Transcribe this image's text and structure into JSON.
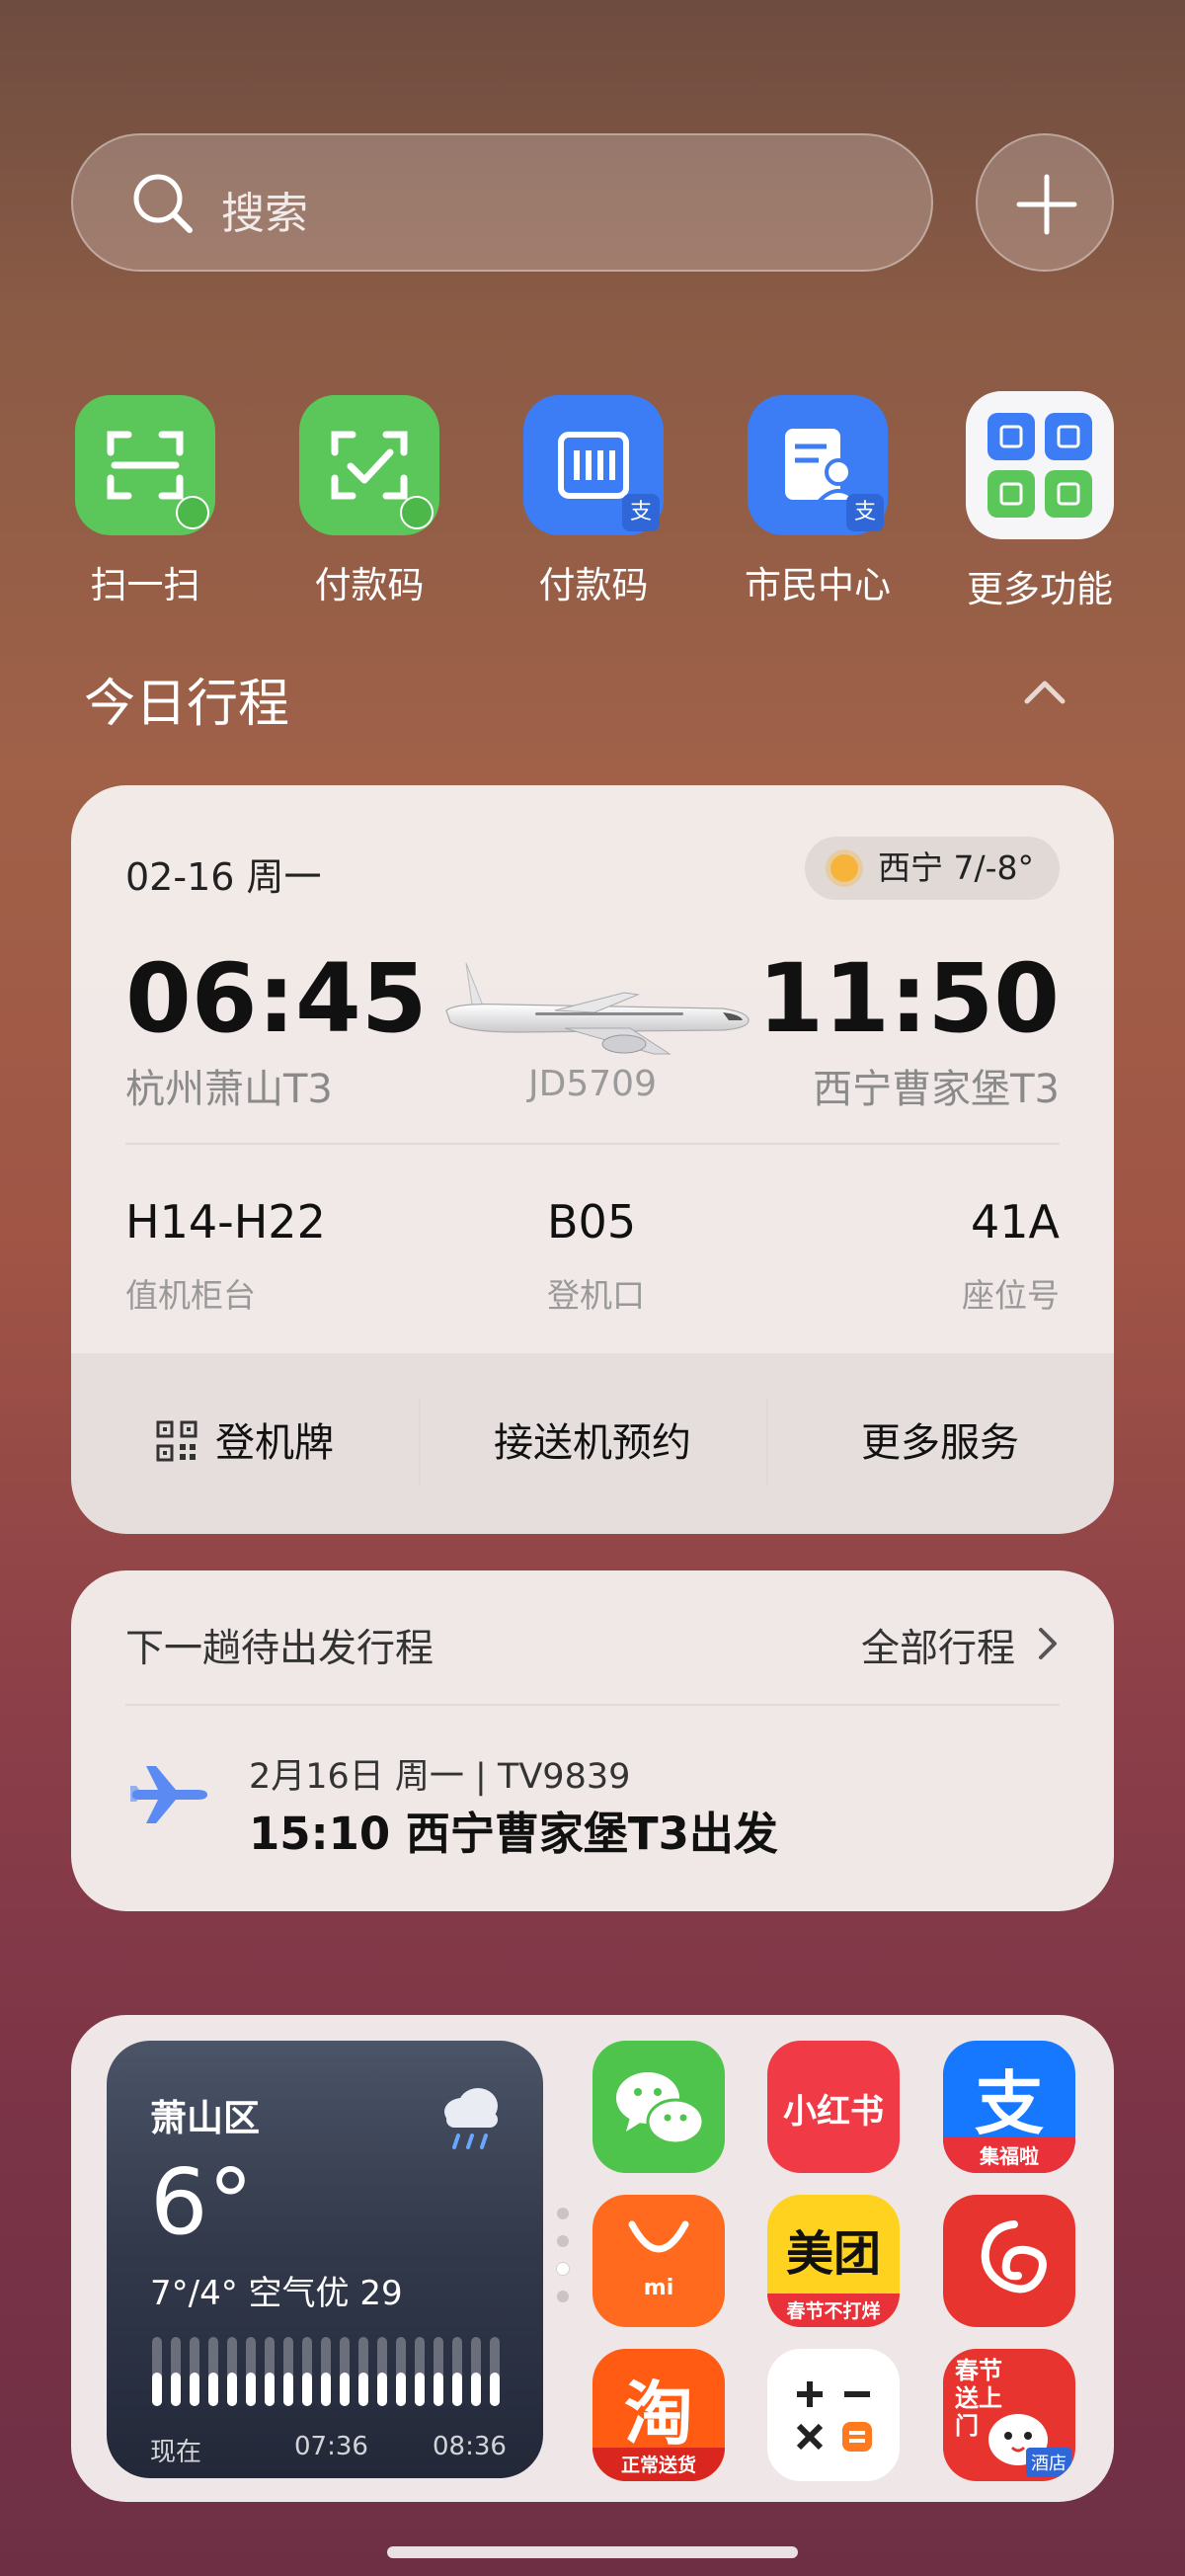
{
  "search": {
    "placeholder": "搜索"
  },
  "quick_actions": [
    {
      "label": "扫一扫",
      "icon": "scan-icon",
      "color": "#5bc65a"
    },
    {
      "label": "付款码",
      "icon": "wechat-pay-code-icon",
      "color": "#5bc65a"
    },
    {
      "label": "付款码",
      "icon": "alipay-pay-code-icon",
      "color": "#3c7cf4"
    },
    {
      "label": "市民中心",
      "icon": "citizen-center-icon",
      "color": "#3c7cf4"
    },
    {
      "label": "更多功能",
      "icon": "more-functions-icon",
      "color": "#f6f6f8"
    }
  ],
  "section": {
    "title": "今日行程"
  },
  "flight": {
    "date": "02-16 周一",
    "weather": "西宁 7/-8°",
    "dep_time": "06:45",
    "arr_time": "11:50",
    "dep_airport": "杭州萧山T3",
    "arr_airport": "西宁曹家堡T3",
    "flight_no": "JD5709",
    "counter_value": "H14-H22",
    "counter_label": "值机柜台",
    "gate_value": "B05",
    "gate_label": "登机口",
    "seat_value": "41A",
    "seat_label": "座位号",
    "actions": [
      "登机牌",
      "接送机预约",
      "更多服务"
    ]
  },
  "next_trip": {
    "title": "下一趟待出发行程",
    "all_label": "全部行程",
    "sub": "2月16日 周一 | TV9839",
    "main": "15:10 西宁曹家堡T3出发"
  },
  "weather_widget": {
    "city": "萧山区",
    "temp": "6°",
    "range": "7°/4° 空气优 29",
    "times": [
      "现在",
      "07:36",
      "08:36"
    ]
  },
  "apps": [
    {
      "name": "wechat",
      "label": "",
      "color": "#4fc44d"
    },
    {
      "name": "xiaohongshu",
      "label": "小红书",
      "color": "#f03a45"
    },
    {
      "name": "alipay",
      "label": "支",
      "sublabel": "集福啦",
      "color": "#1677ff"
    },
    {
      "name": "mi-store",
      "label": "mi",
      "color": "#ff6a1f"
    },
    {
      "name": "meituan",
      "label": "美团",
      "sublabel": "春节不打烊",
      "color": "#ffd21f"
    },
    {
      "name": "netease-music",
      "label": "",
      "color": "#e8342f"
    },
    {
      "name": "taobao",
      "label": "淘",
      "sublabel": "正常送货",
      "color": "#ff5b12"
    },
    {
      "name": "calculator",
      "label": "",
      "color": "#ffffff"
    },
    {
      "name": "jd",
      "label": "春节送上门",
      "sublabel": "酒店",
      "color": "#e8342f"
    }
  ]
}
